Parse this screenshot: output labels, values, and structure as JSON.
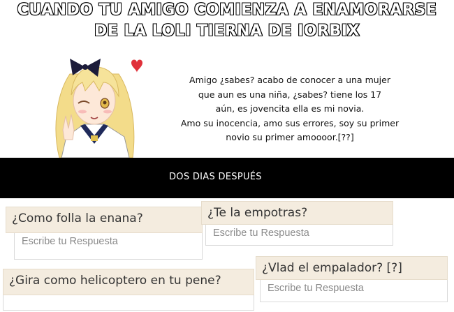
{
  "header": {
    "line1": "CUANDO TU AMIGO COMIENZA A ENAMORARSE",
    "line2": "DE LA LOLI TIERNA DE IORBIX"
  },
  "message": {
    "lines": [
      "Amigo ¿sabes? acabo de conocer a una mujer",
      "que aun es una niña, ¿sabes? tiene los 17",
      "aún, es jovencita ella es mi novia.",
      "Amo su inocencia, amo sus errores, soy su primer",
      "novio su primer amoooor.[??]"
    ]
  },
  "band": {
    "text": "DOS DIAS DESPUÉS"
  },
  "questions": [
    {
      "question": "¿Como folla la enana?",
      "placeholder": "Escribe tu Respuesta"
    },
    {
      "question": "¿Te la empotras?",
      "placeholder": "Escribe tu Respuesta"
    },
    {
      "question": "¿Gira como helicoptero en tu pene?",
      "placeholder": ""
    },
    {
      "question": "¿Vlad el empalador? [?]",
      "placeholder": "Escribe tu Respuesta"
    }
  ],
  "colors": {
    "band": "#000000",
    "card_header": "#f4ecdf",
    "heart": "#e0303a",
    "hair": "#f3dc8a",
    "bow": "#1c1c3a"
  },
  "icons": [
    "heart-icon",
    "anime-girl-illustration"
  ]
}
